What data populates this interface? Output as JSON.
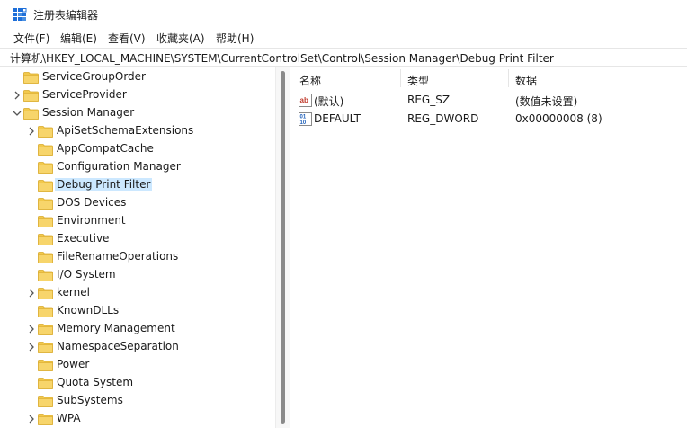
{
  "window": {
    "title": "注册表编辑器"
  },
  "menu": [
    "文件(F)",
    "编辑(E)",
    "查看(V)",
    "收藏夹(A)",
    "帮助(H)"
  ],
  "address": "计算机\\HKEY_LOCAL_MACHINE\\SYSTEM\\CurrentControlSet\\Control\\Session Manager\\Debug Print Filter",
  "tree": [
    {
      "label": "ServiceGroupOrder",
      "expander": "none"
    },
    {
      "label": "ServiceProvider",
      "expander": "collapsed"
    },
    {
      "label": "Session Manager",
      "expander": "expanded"
    },
    {
      "label": "ApiSetSchemaExtensions",
      "expander": "collapsed"
    },
    {
      "label": "AppCompatCache",
      "expander": "none"
    },
    {
      "label": "Configuration Manager",
      "expander": "none"
    },
    {
      "label": "Debug Print Filter",
      "expander": "none",
      "selected": true
    },
    {
      "label": "DOS Devices",
      "expander": "none"
    },
    {
      "label": "Environment",
      "expander": "none"
    },
    {
      "label": "Executive",
      "expander": "none"
    },
    {
      "label": "FileRenameOperations",
      "expander": "none"
    },
    {
      "label": "I/O System",
      "expander": "none"
    },
    {
      "label": "kernel",
      "expander": "collapsed"
    },
    {
      "label": "KnownDLLs",
      "expander": "none"
    },
    {
      "label": "Memory Management",
      "expander": "collapsed"
    },
    {
      "label": "NamespaceSeparation",
      "expander": "collapsed"
    },
    {
      "label": "Power",
      "expander": "none"
    },
    {
      "label": "Quota System",
      "expander": "none"
    },
    {
      "label": "SubSystems",
      "expander": "none"
    },
    {
      "label": "WPA",
      "expander": "collapsed"
    }
  ],
  "columns": {
    "name": "名称",
    "type": "类型",
    "data": "数据"
  },
  "values": [
    {
      "name": "(默认)",
      "type": "REG_SZ",
      "data": "(数值未设置)",
      "icon": "string-value-icon"
    },
    {
      "name": "DEFAULT",
      "type": "REG_DWORD",
      "data": "0x00000008 (8)",
      "icon": "binary-value-icon"
    }
  ],
  "colors": {
    "selection": "#cce8ff",
    "folder": "#f2c94c",
    "app_icon": "#1e6fd9"
  }
}
